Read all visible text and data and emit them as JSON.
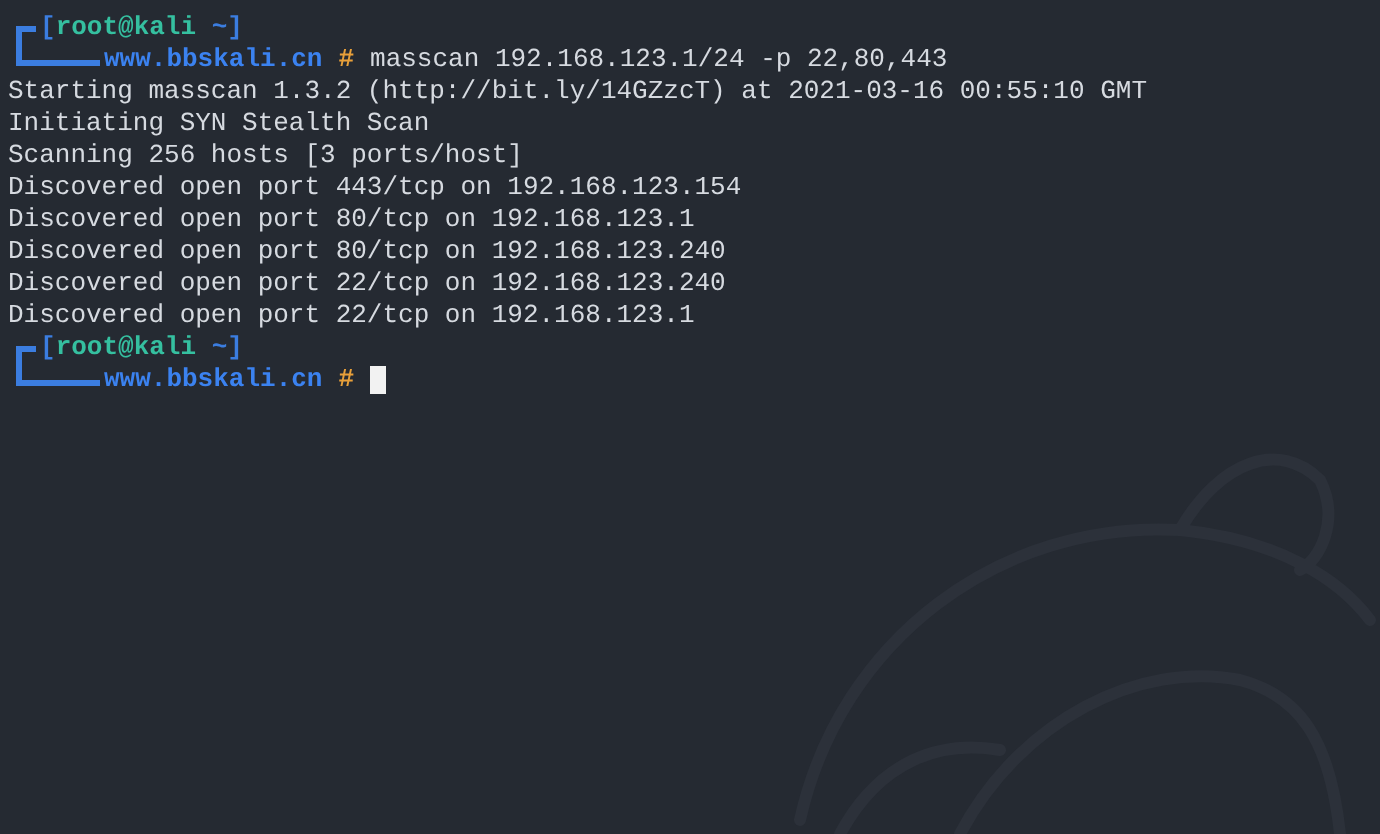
{
  "terminal": {
    "lines": [
      {
        "kind": "prompt",
        "open": "[",
        "user": "root@kali",
        "dir": "~",
        "close": "]",
        "host": "www.bbskali.cn",
        "symbol": "#",
        "command": "masscan 192.168.123.1/24 -p 22,80,443",
        "cursor": false
      },
      {
        "kind": "output",
        "text": "Starting masscan 1.3.2 (http://bit.ly/14GZzcT) at 2021-03-16 00:55:10 GMT"
      },
      {
        "kind": "output",
        "text": "Initiating SYN Stealth Scan"
      },
      {
        "kind": "output",
        "text": "Scanning 256 hosts [3 ports/host]"
      },
      {
        "kind": "output",
        "text": "Discovered open port 443/tcp on 192.168.123.154"
      },
      {
        "kind": "output",
        "text": "Discovered open port 80/tcp on 192.168.123.1"
      },
      {
        "kind": "output",
        "text": "Discovered open port 80/tcp on 192.168.123.240"
      },
      {
        "kind": "output",
        "text": "Discovered open port 22/tcp on 192.168.123.240"
      },
      {
        "kind": "output",
        "text": "Discovered open port 22/tcp on 192.168.123.1"
      },
      {
        "kind": "prompt",
        "open": "[",
        "user": "root@kali",
        "dir": "~",
        "close": "]",
        "host": "www.bbskali.cn",
        "symbol": "#",
        "cursor": true
      }
    ]
  }
}
